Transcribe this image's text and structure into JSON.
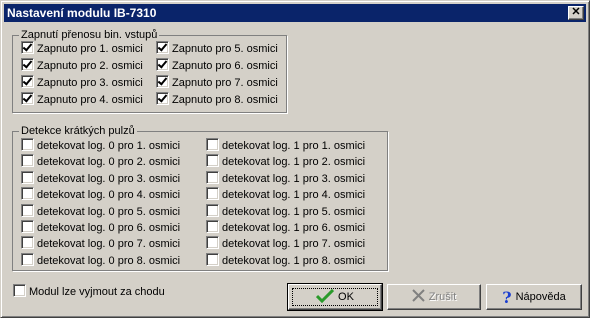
{
  "dialog": {
    "title": "Nastavení modulu IB-7310",
    "close_symbol": "✕"
  },
  "transfer_group": {
    "label": "Zapnutí přenosu bin. vstupů",
    "items": [
      {
        "label": "Zapnuto pro 1. osmici",
        "checked": true
      },
      {
        "label": "Zapnuto pro 2. osmici",
        "checked": true
      },
      {
        "label": "Zapnuto pro 3. osmici",
        "checked": true
      },
      {
        "label": "Zapnuto pro 4. osmici",
        "checked": true
      },
      {
        "label": "Zapnuto pro 5. osmici",
        "checked": true
      },
      {
        "label": "Zapnuto pro 6. osmici",
        "checked": true
      },
      {
        "label": "Zapnuto pro 7. osmici",
        "checked": true
      },
      {
        "label": "Zapnuto pro 8. osmici",
        "checked": true
      }
    ]
  },
  "pulse_group": {
    "label": "Detekce krátkých pulzů",
    "log0": [
      {
        "label": "detekovat log. 0 pro 1. osmici",
        "checked": false
      },
      {
        "label": "detekovat log. 0 pro 2. osmici",
        "checked": false
      },
      {
        "label": "detekovat log. 0 pro 3. osmici",
        "checked": false
      },
      {
        "label": "detekovat log. 0 pro 4. osmici",
        "checked": false
      },
      {
        "label": "detekovat log. 0 pro 5. osmici",
        "checked": false
      },
      {
        "label": "detekovat log. 0 pro 6. osmici",
        "checked": false
      },
      {
        "label": "detekovat log. 0 pro 7. osmici",
        "checked": false
      },
      {
        "label": "detekovat log. 0 pro 8. osmici",
        "checked": false
      }
    ],
    "log1": [
      {
        "label": "detekovat log. 1 pro 1. osmici",
        "checked": false
      },
      {
        "label": "detekovat log. 1 pro 2. osmici",
        "checked": false
      },
      {
        "label": "detekovat log. 1 pro 3. osmici",
        "checked": false
      },
      {
        "label": "detekovat log. 1 pro 4. osmici",
        "checked": false
      },
      {
        "label": "detekovat log. 1 pro 5. osmici",
        "checked": false
      },
      {
        "label": "detekovat log. 1 pro 6. osmici",
        "checked": false
      },
      {
        "label": "detekovat log. 1 pro 7. osmici",
        "checked": false
      },
      {
        "label": "detekovat log. 1 pro 8. osmici",
        "checked": false
      }
    ]
  },
  "hotswap": {
    "label": "Modul lze vyjmout za chodu",
    "checked": false
  },
  "buttons": {
    "ok": {
      "label": "OK",
      "icon": "checkmark-icon",
      "icon_color": "#2a9a2a"
    },
    "cancel": {
      "label": "Zrušit",
      "icon": "cross-icon",
      "disabled": true
    },
    "help": {
      "label": "Nápověda",
      "icon": "question-icon",
      "icon_color": "#1c3fd1"
    }
  },
  "colors": {
    "titlebar": "#0a246a",
    "face": "#d4d0c8"
  }
}
